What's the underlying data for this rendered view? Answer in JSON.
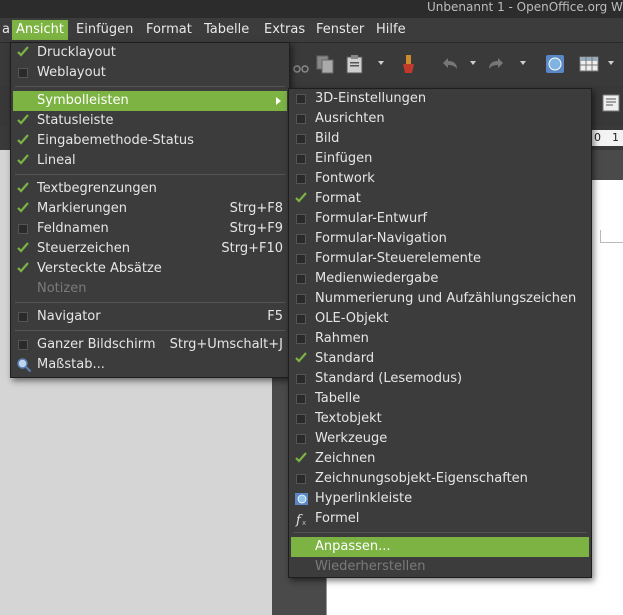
{
  "window": {
    "title": "Unbenannt 1 - OpenOffice.org Writ"
  },
  "menubar": [
    {
      "label": "Ansicht",
      "active": true
    },
    {
      "label": "Einfügen"
    },
    {
      "label": "Format"
    },
    {
      "label": "Tabelle"
    },
    {
      "label": "Extras"
    },
    {
      "label": "Fenster"
    },
    {
      "label": "Hilfe"
    }
  ],
  "menubar_partial": "a",
  "ruler": {
    "labels": [
      "0",
      "1"
    ]
  },
  "ansicht_menu": {
    "items": [
      {
        "label": "Drucklayout",
        "check": "on"
      },
      {
        "label": "Weblayout",
        "check": "off"
      },
      {
        "label": "Symbolleisten",
        "submenu": true,
        "highlighted": true
      },
      {
        "label": "Statusleiste",
        "check": "on"
      },
      {
        "label": "Eingabemethode-Status",
        "check": "on"
      },
      {
        "label": "Lineal",
        "check": "on"
      },
      {
        "label": "Textbegrenzungen",
        "check": "on"
      },
      {
        "label": "Markierungen",
        "check": "on",
        "shortcut": "Strg+F8"
      },
      {
        "label": "Feldnamen",
        "check": "off",
        "shortcut": "Strg+F9"
      },
      {
        "label": "Steuerzeichen",
        "check": "on",
        "shortcut": "Strg+F10"
      },
      {
        "label": "Versteckte Absätze",
        "check": "on"
      },
      {
        "label": "Notizen",
        "disabled": true
      },
      {
        "label": "Navigator",
        "check": "off",
        "shortcut": "F5"
      },
      {
        "label": "Ganzer Bildschirm",
        "check": "off",
        "shortcut": "Strg+Umschalt+J"
      },
      {
        "label": "Maßstab...",
        "icon": "zoom-icon"
      }
    ]
  },
  "symbolleisten_menu": {
    "items": [
      {
        "label": "3D-Einstellungen",
        "check": "off"
      },
      {
        "label": "Ausrichten",
        "check": "off"
      },
      {
        "label": "Bild",
        "check": "off"
      },
      {
        "label": "Einfügen",
        "check": "off"
      },
      {
        "label": "Fontwork",
        "check": "off"
      },
      {
        "label": "Format",
        "check": "on"
      },
      {
        "label": "Formular-Entwurf",
        "check": "off"
      },
      {
        "label": "Formular-Navigation",
        "check": "off"
      },
      {
        "label": "Formular-Steuerelemente",
        "check": "off"
      },
      {
        "label": "Medienwiedergabe",
        "check": "off"
      },
      {
        "label": "Nummerierung und Aufzählungszeichen",
        "check": "off"
      },
      {
        "label": "OLE-Objekt",
        "check": "off"
      },
      {
        "label": "Rahmen",
        "check": "off"
      },
      {
        "label": "Standard",
        "check": "on"
      },
      {
        "label": "Standard (Lesemodus)",
        "check": "off"
      },
      {
        "label": "Tabelle",
        "check": "off"
      },
      {
        "label": "Textobjekt",
        "check": "off"
      },
      {
        "label": "Werkzeuge",
        "check": "off"
      },
      {
        "label": "Zeichnen",
        "check": "on"
      },
      {
        "label": "Zeichnungsobjekt-Eigenschaften",
        "check": "off"
      },
      {
        "label": "Hyperlinkleiste",
        "icon": "hyperlink-icon"
      },
      {
        "label": "Formel",
        "icon": "formula-icon"
      },
      {
        "label": "Anpassen...",
        "highlighted": true
      },
      {
        "label": "Wiederherstellen",
        "disabled": true
      }
    ]
  },
  "colors": {
    "accent": "#7cb342",
    "menu_bg": "#3c3c3c",
    "text": "#e6e6e6"
  }
}
